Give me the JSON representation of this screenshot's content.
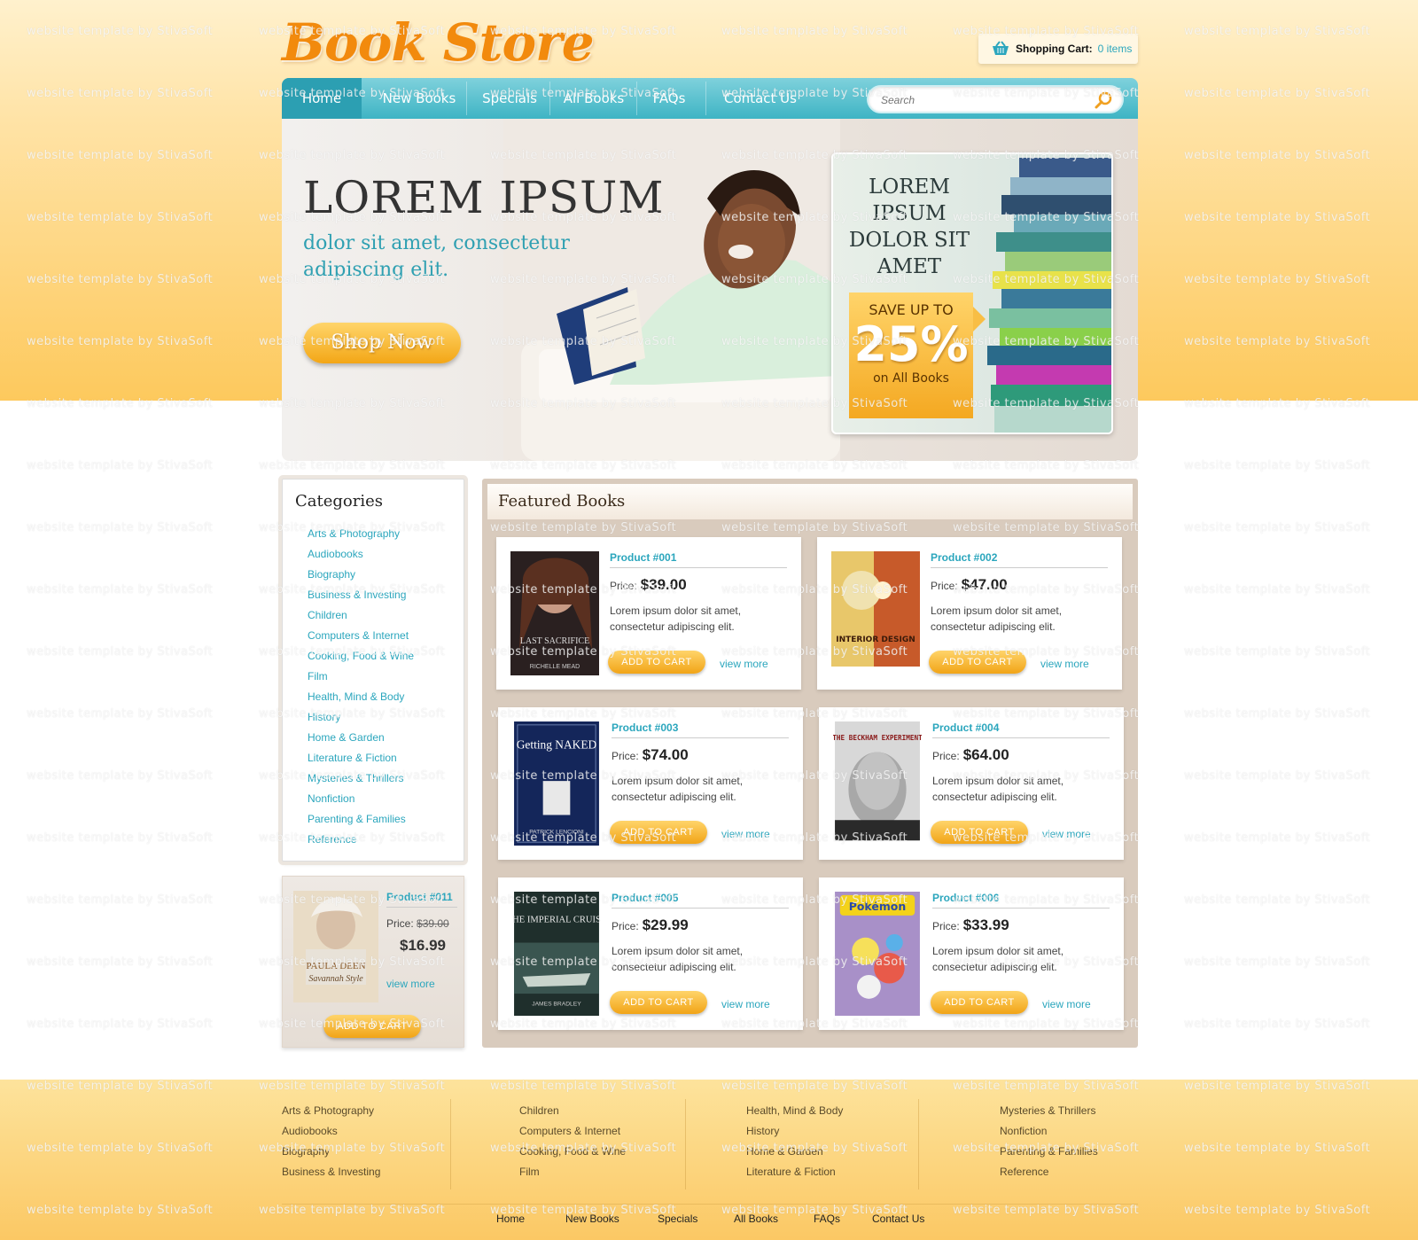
{
  "header": {
    "logo": "Book Store",
    "cart_label": "Shopping Cart:",
    "cart_count": "0 items"
  },
  "nav": {
    "items": [
      "Home",
      "New Books",
      "Specials",
      "All Books",
      "FAQs",
      "Contact Us"
    ],
    "search_placeholder": "Search"
  },
  "hero": {
    "title": "LOREM IPSUM",
    "subtitle": "dolor sit amet, consectetur adipiscing elit.",
    "cta": "Shop Now",
    "promo_text": "LOREM IPSUM DOLOR SIT AMET",
    "save_line1": "SAVE UP TO",
    "save_percent": "25%",
    "save_line3": "on All Books"
  },
  "categories": {
    "title": "Categories",
    "items": [
      "Arts & Photography",
      "Audiobooks",
      "Biography",
      "Business & Investing",
      "Children",
      "Computers & Internet",
      "Cooking, Food & Wine",
      "Film",
      "Health, Mind & Body",
      "History",
      "Home & Garden",
      "Literature & Fiction",
      "Mysteries & Thrillers",
      "Nonfiction",
      "Parenting & Families",
      "Reference"
    ]
  },
  "side_product": {
    "name": "Product #011",
    "price_label": "Price:",
    "old_price": "$39.00",
    "new_price": "$16.99",
    "view_more": "view more",
    "add_to_cart": "ADD TO CART"
  },
  "featured": {
    "title": "Featured Books",
    "price_label": "Price:",
    "add_to_cart": "ADD TO CART",
    "view_more": "view more",
    "products": [
      {
        "name": "Product #001",
        "price": "$39.00",
        "desc": "Lorem ipsum dolor sit amet, consectetur adipiscing elit."
      },
      {
        "name": "Product #002",
        "price": "$47.00",
        "desc": "Lorem ipsum dolor sit amet, consectetur adipiscing elit."
      },
      {
        "name": "Product #003",
        "price": "$74.00",
        "desc": "Lorem ipsum dolor sit amet, consectetur adipiscing elit."
      },
      {
        "name": "Product #004",
        "price": "$64.00",
        "desc": "Lorem ipsum dolor sit amet, consectetur adipiscing elit."
      },
      {
        "name": "Product #005",
        "price": "$29.99",
        "desc": "Lorem ipsum dolor sit amet, consectetur adipiscing elit."
      },
      {
        "name": "Product #006",
        "price": "$33.99",
        "desc": "Lorem ipsum dolor sit amet, consectetur adipiscing elit."
      }
    ]
  },
  "covers": {
    "c3_title": "Getting NAKED",
    "c3_author": "PATRICK LENCIONI",
    "c4_title": "THE BECKHAM EXPERIMENT",
    "c5_title": "THE IMPERIAL CRUISE",
    "c5_author": "JAMES BRADLEY",
    "c6_title": "Pokémon",
    "c2_title": "INTERIOR DESIGN",
    "c1_title": "LAST SACRIFICE",
    "c1_author": "RICHELLE MEAD",
    "c11_title": "PAULA DEEN",
    "c11_sub": "Savannah Style"
  },
  "footer": {
    "col1": [
      "Arts & Photography",
      "Audiobooks",
      "Biography",
      "Business & Investing"
    ],
    "col2": [
      "Children",
      "Computers & Internet",
      "Cooking, Food & Wine",
      "Film"
    ],
    "col3": [
      "Health, Mind & Body",
      "History",
      "Home & Garden",
      "Literature & Fiction"
    ],
    "col4": [
      "Mysteries & Thrillers",
      "Nonfiction",
      "Parenting & Families",
      "Reference"
    ],
    "nav": [
      "Home",
      "New Books",
      "Specials",
      "All Books",
      "FAQs",
      "Contact Us"
    ]
  },
  "watermark": "website template by StivaSoft",
  "colors": {
    "accent_teal": "#2ba6bd",
    "accent_orange": "#f28a0d",
    "button_gold": "#f4a821"
  }
}
